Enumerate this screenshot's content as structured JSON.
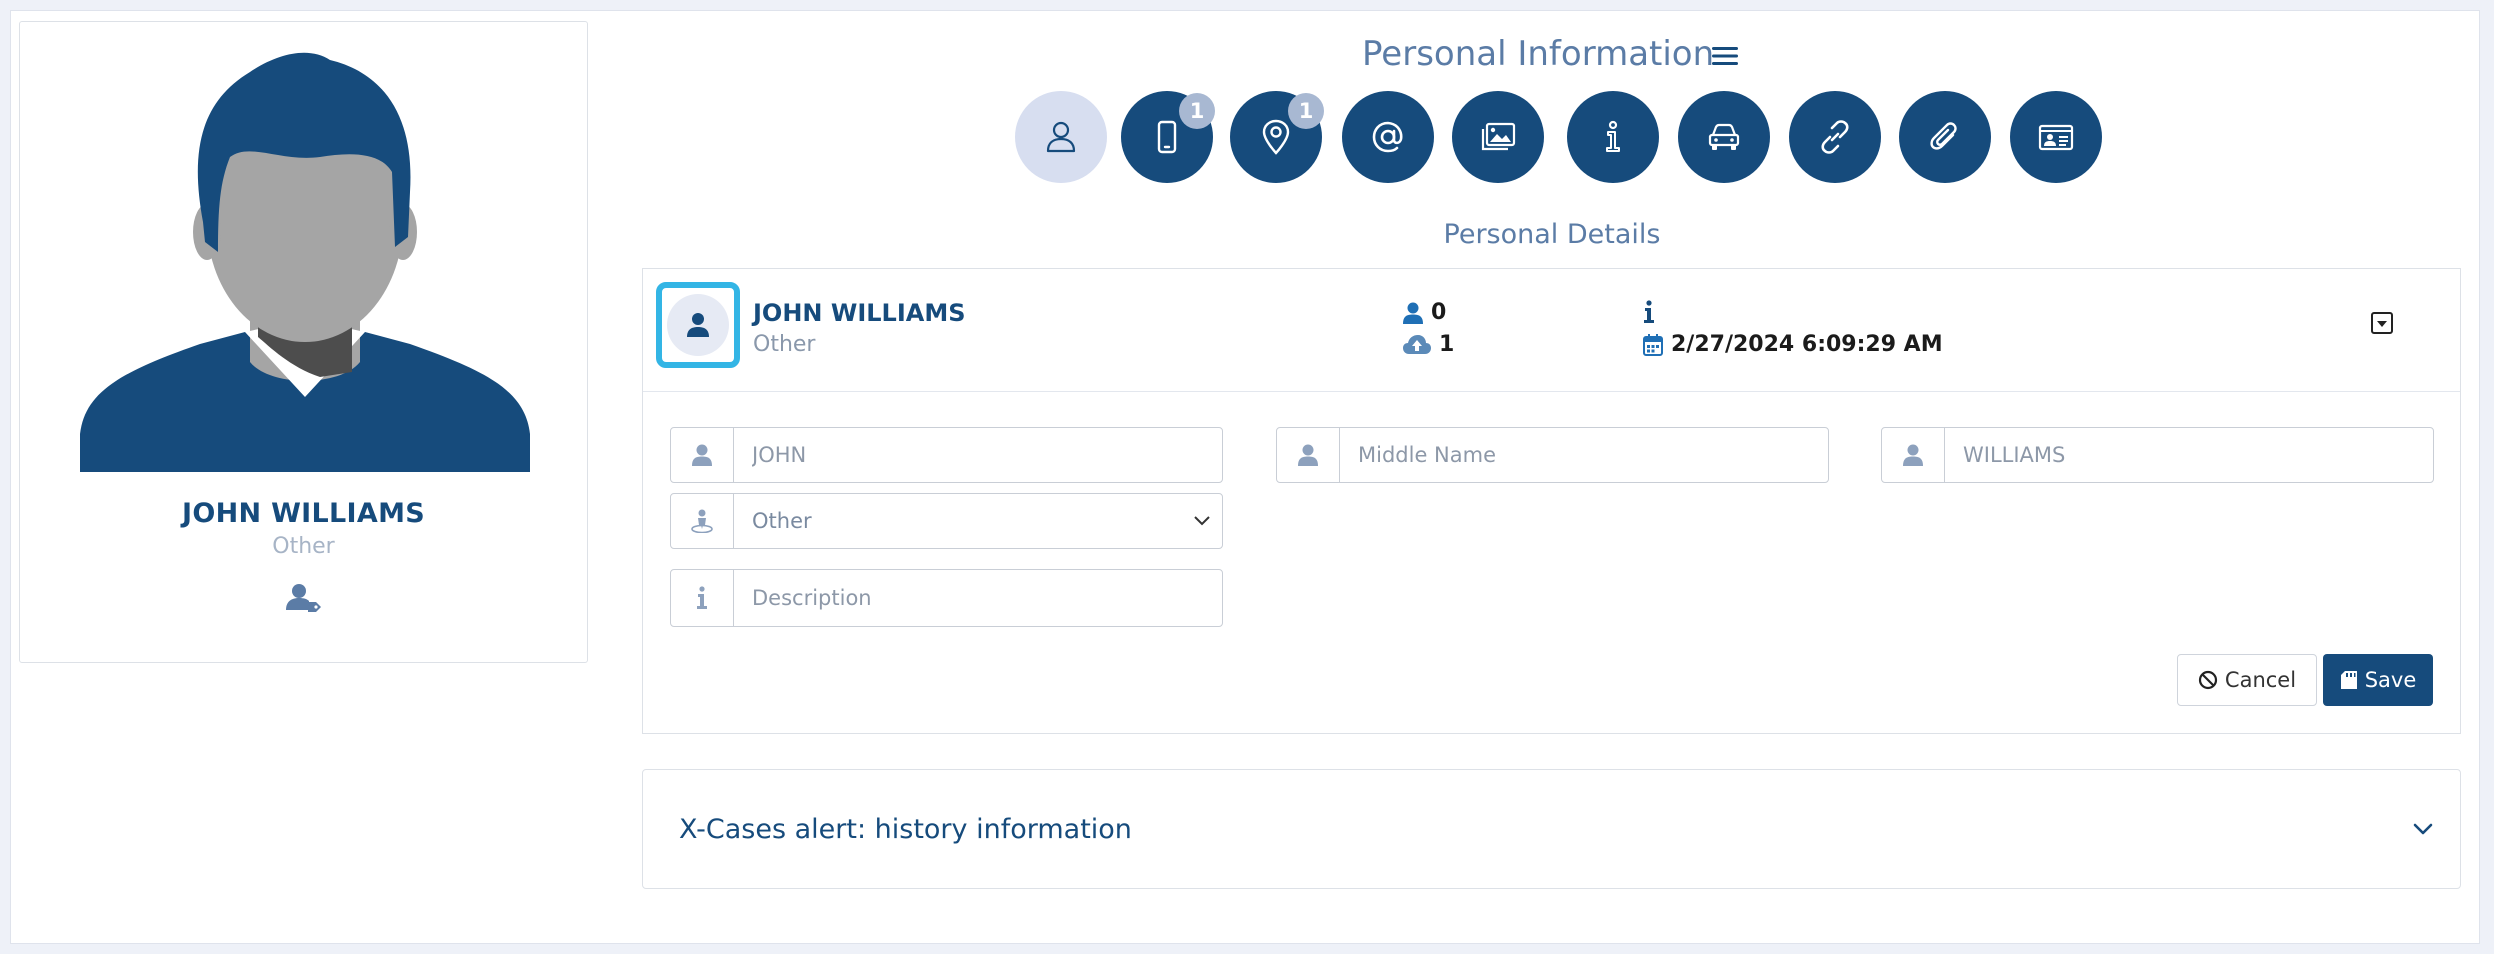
{
  "header": {
    "title": "Personal Information"
  },
  "tabs": [
    {
      "name": "person",
      "icon": "person-outline-icon",
      "active": true,
      "badge": ""
    },
    {
      "name": "phone",
      "icon": "mobile-phone-icon",
      "active": false,
      "badge": "1"
    },
    {
      "name": "location",
      "icon": "map-pin-icon",
      "active": false,
      "badge": "1"
    },
    {
      "name": "email",
      "icon": "at-sign-icon",
      "active": false,
      "badge": ""
    },
    {
      "name": "images",
      "icon": "images-icon",
      "active": false,
      "badge": ""
    },
    {
      "name": "info",
      "icon": "info-icon",
      "active": false,
      "badge": ""
    },
    {
      "name": "vehicle",
      "icon": "car-icon",
      "active": false,
      "badge": ""
    },
    {
      "name": "links",
      "icon": "link-icon",
      "active": false,
      "badge": ""
    },
    {
      "name": "attachments",
      "icon": "paperclip-icon",
      "active": false,
      "badge": ""
    },
    {
      "name": "id-card",
      "icon": "id-card-icon",
      "active": false,
      "badge": ""
    }
  ],
  "section": {
    "title": "Personal Details"
  },
  "profile": {
    "name": "JOHN WILLIAMS",
    "role": "Other"
  },
  "details": {
    "name": "JOHN WILLIAMS",
    "role": "Other",
    "count_people": "0",
    "count_uploads": "1",
    "info": "",
    "timestamp": "2/27/2024 6:09:29 AM"
  },
  "form": {
    "first_name": {
      "value": "",
      "placeholder": "JOHN"
    },
    "middle_name": {
      "value": "",
      "placeholder": "Middle Name"
    },
    "last_name": {
      "value": "",
      "placeholder": "WILLIAMS"
    },
    "category": {
      "selected": "Other"
    },
    "description": {
      "value": "",
      "placeholder": "Description"
    }
  },
  "actions": {
    "cancel_label": "Cancel",
    "save_label": "Save"
  },
  "alert": {
    "title": "X-Cases alert: history information"
  },
  "colors": {
    "primary": "#164b7c",
    "accent_border": "#33b5e5",
    "tab_active_bg": "#d7def0",
    "badge_bg": "#a8b8d2",
    "title_text": "#5b7ca6"
  }
}
